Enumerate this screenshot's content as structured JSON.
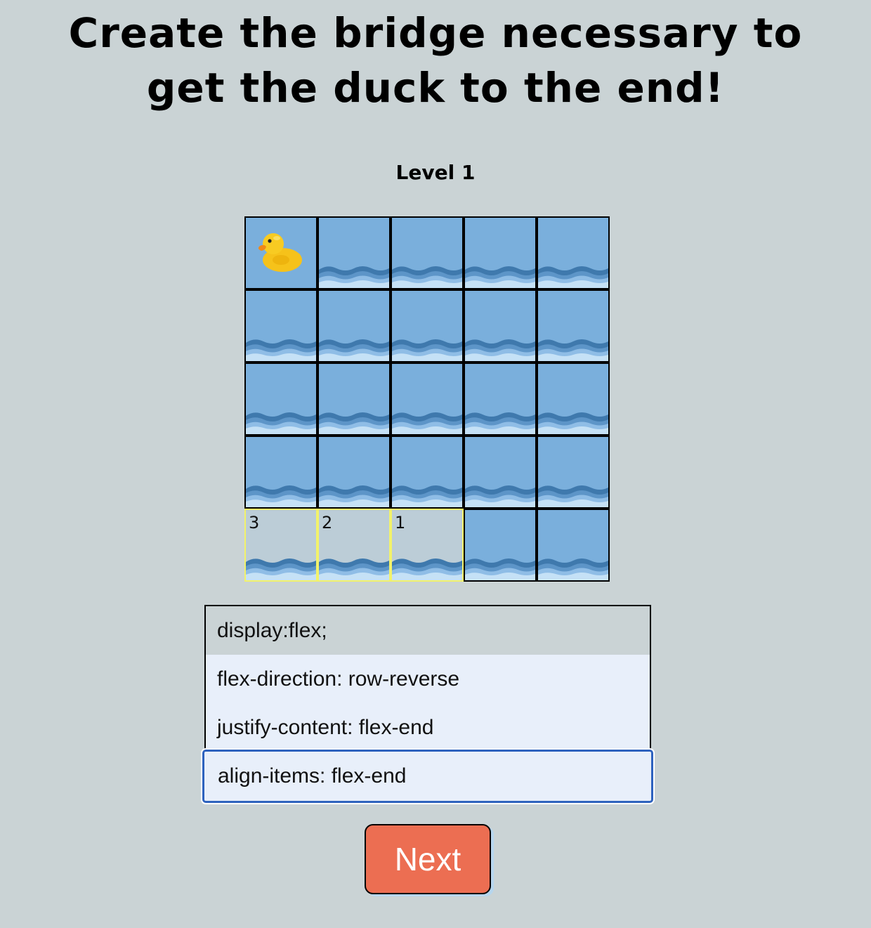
{
  "title": {
    "line1": "Create the bridge necessary to",
    "line2": "get the duck to the end!"
  },
  "level": {
    "label": "Level 1"
  },
  "board": {
    "rows": 5,
    "cols": 5,
    "duck": {
      "row": 0,
      "col": 0
    },
    "bridge_tiles": [
      {
        "row": 4,
        "col": 0,
        "label": "3"
      },
      {
        "row": 4,
        "col": 1,
        "label": "2"
      },
      {
        "row": 4,
        "col": 2,
        "label": "1"
      }
    ],
    "colors": {
      "water": "#7aafdc",
      "bridge": "#bccdd7",
      "bridge_border": "#f2f26a"
    }
  },
  "editor": {
    "lines": [
      "display:flex;",
      "flex-direction: row-reverse",
      "justify-content: flex-end"
    ],
    "input_value": "align-items: flex-end"
  },
  "next_button": {
    "label": "Next",
    "color": "#ec6e52"
  },
  "colors": {
    "background": "#cad3d5",
    "input_focus": "#2e62be"
  }
}
